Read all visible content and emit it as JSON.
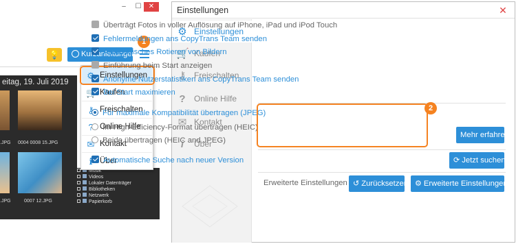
{
  "app": {
    "window_controls": {
      "minimize": "–",
      "maximize": "☐",
      "close": "✕"
    },
    "step1": "1",
    "tips_button_icon": "lightbulb-icon",
    "guides_button_label": "Kurzanleitungen",
    "menu_icon": "hamburger-menu-icon",
    "photo_date": "eitag, 19. Juli 2019",
    "thumbnails": [
      {
        "caption": ".JPG"
      },
      {
        "caption": "0004 0008 15.JPG"
      },
      {
        "caption": ".JPG"
      },
      {
        "caption": "0007 12.JPG"
      }
    ],
    "tree_items": [
      "Musik",
      "Videos",
      "Lokaler Datenträger",
      "Bibliotheken",
      "Netzwerk",
      "Papierkorb"
    ]
  },
  "dropdown": {
    "items": [
      {
        "label": "Einstellungen",
        "icon": "gears-icon"
      },
      {
        "label": "Kaufen",
        "icon": "cart-icon"
      },
      {
        "label": "Freischalten",
        "icon": "key-icon"
      },
      {
        "label": "Online Hilfe",
        "icon": "question-icon"
      },
      {
        "label": "Kontakt",
        "icon": "envelope-icon"
      },
      {
        "label": "Über",
        "icon": "info-icon"
      }
    ]
  },
  "dialog": {
    "title": "Einstellungen",
    "close": "✕",
    "nav": [
      {
        "label": "Einstellungen",
        "icon": "gears-icon"
      },
      {
        "label": "Kaufen",
        "icon": "cart-icon"
      },
      {
        "label": "Freischalten",
        "icon": "key-icon"
      },
      {
        "label": "Online Hilfe",
        "icon": "question-icon"
      },
      {
        "label": "Kontakt",
        "icon": "envelope-icon"
      },
      {
        "label": "Über",
        "icon": "info-icon"
      }
    ],
    "options": [
      {
        "label": "Überträgt Fotos in voller Auflösung auf iPhone, iPad und iPod Touch",
        "checked": false
      },
      {
        "label": "Fehlermeldungen ans CopyTrans Team senden",
        "checked": true
      },
      {
        "label": "Automatisches Rotieren von Bildern",
        "checked": true
      },
      {
        "label": "Einführung beim Start anzeigen",
        "checked": false
      },
      {
        "label": "Anonyme Nutzerstatistiken ans CopyTrans Team senden",
        "checked": true
      },
      {
        "label": "Bei Start maximieren",
        "checked": true
      }
    ],
    "step2": "2",
    "radios": [
      {
        "label": "Für maximale Kompatibilität übertragen (JPEG)",
        "selected": true
      },
      {
        "label": "Im High-Efficiency-Format übertragen (HEIC)",
        "selected": false
      },
      {
        "label": "Beide übertragen (HEIC and JPEG)",
        "selected": false
      }
    ],
    "learn_more": "Mehr erfahren",
    "auto_update": {
      "label": "Automatische Suche nach neuer Version",
      "checked": true
    },
    "check_now": "Jetzt suchen",
    "advanced_label": "Erweiterte Einstellungen",
    "reset": "Zurücksetzen",
    "advanced_button": "Erweiterte Einstellungen..."
  },
  "colors": {
    "accent": "#2d8fd8",
    "highlight": "#f58220",
    "close": "#e04343"
  }
}
